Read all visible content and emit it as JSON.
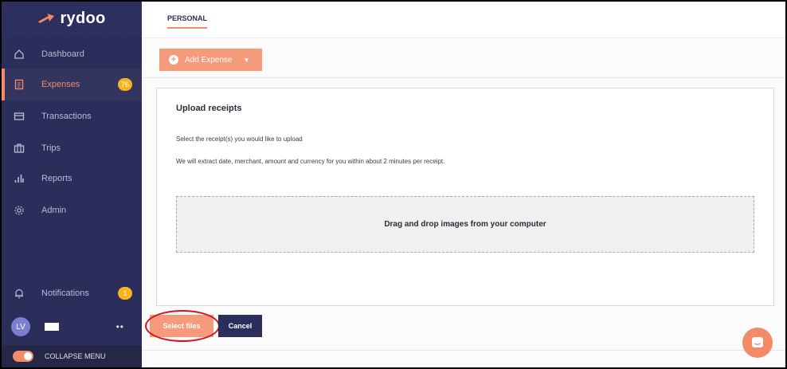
{
  "brand": {
    "name": "rydoo",
    "accent": "#f38a68",
    "sidebar_bg": "#2b2d5a"
  },
  "sidebar": {
    "items": [
      {
        "label": "Dashboard",
        "icon": "home-icon",
        "active": false
      },
      {
        "label": "Expenses",
        "icon": "receipt-icon",
        "active": true,
        "badge": "76"
      },
      {
        "label": "Transactions",
        "icon": "credit-card-icon",
        "active": false
      },
      {
        "label": "Trips",
        "icon": "suitcase-icon",
        "active": false
      },
      {
        "label": "Reports",
        "icon": "bar-chart-icon",
        "active": false
      },
      {
        "label": "Admin",
        "icon": "gear-icon",
        "active": false
      }
    ],
    "notifications": {
      "label": "Notifications",
      "icon": "bell-icon",
      "badge": "1"
    },
    "user": {
      "initials": "LV",
      "menu": "••"
    },
    "collapse": {
      "label": "COLLAPSE MENU"
    }
  },
  "header": {
    "tab": "PERSONAL"
  },
  "toolbar": {
    "add_label": "Add Expense"
  },
  "upload": {
    "title": "Upload receipts",
    "line1": "Select the receipt(s) you would like to upload",
    "line2": "We will extract date, merchant, amount and currency for you within about 2 minutes per receipt.",
    "dropzone": "Drag and drop images from your computer",
    "select_label": "Select files",
    "cancel_label": "Cancel"
  }
}
